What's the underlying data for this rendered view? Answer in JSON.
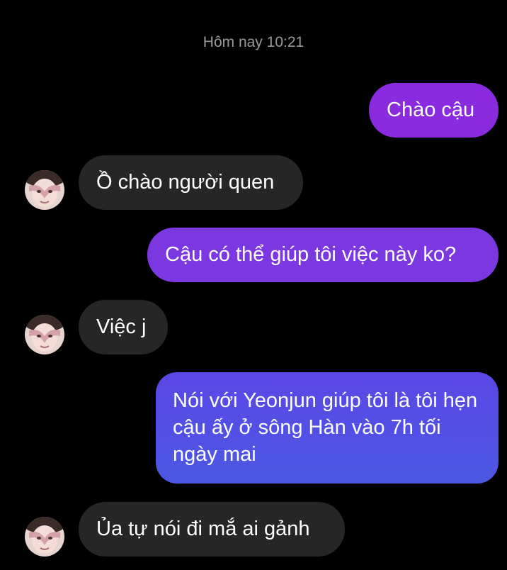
{
  "conversation": {
    "timestamp": "Hôm nay 10:21",
    "messages": [
      {
        "direction": "outgoing",
        "text": "Chào cậu"
      },
      {
        "direction": "incoming",
        "text": "Ồ chào người quen"
      },
      {
        "direction": "outgoing",
        "text": "Cậu có thể giúp tôi việc này ko?"
      },
      {
        "direction": "incoming",
        "text": "Việc j"
      },
      {
        "direction": "outgoing",
        "text": "Nói với Yeonjun giúp tôi là tôi hẹn cậu ấy ở sông Hàn vào 7h tối ngày mai"
      },
      {
        "direction": "incoming",
        "text": "Ủa tự nói đi mắ ai gảnh"
      }
    ]
  },
  "colors": {
    "background": "#000000",
    "outgoing_bubble_top": "#8a2be0",
    "outgoing_bubble_bottom": "#4b58e2",
    "incoming_bubble": "#262626",
    "timestamp_text": "#9a9a9a",
    "message_text": "#ffffff"
  },
  "icons": {
    "contact_avatar": "contact-avatar-photo"
  }
}
